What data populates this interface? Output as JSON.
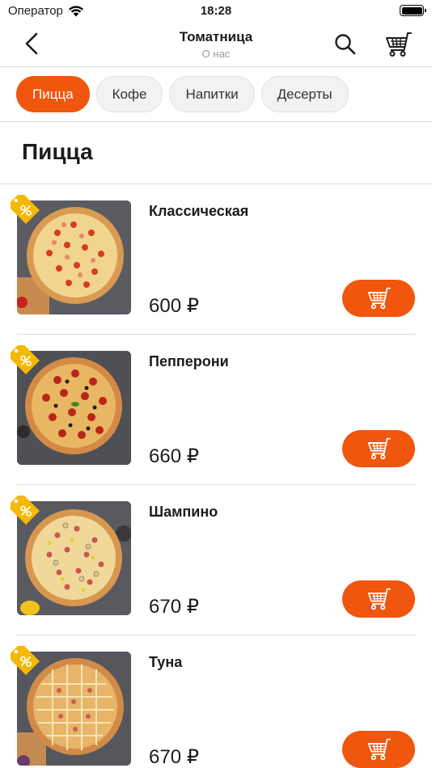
{
  "status_bar": {
    "carrier": "Оператор",
    "time": "18:28"
  },
  "nav": {
    "title": "Томатница",
    "subtitle": "О нас"
  },
  "categories": [
    {
      "label": "Пицца",
      "active": true
    },
    {
      "label": "Кофе",
      "active": false
    },
    {
      "label": "Напитки",
      "active": false
    },
    {
      "label": "Десерты",
      "active": false
    }
  ],
  "section": {
    "title": "Пицца"
  },
  "products": [
    {
      "name": "Классическая",
      "price": "600 ₽",
      "discount_badge": "%"
    },
    {
      "name": "Пепперони",
      "price": "660 ₽",
      "discount_badge": "%"
    },
    {
      "name": "Шампино",
      "price": "670 ₽",
      "discount_badge": "%"
    },
    {
      "name": "Туна",
      "price": "670 ₽",
      "discount_badge": "%"
    }
  ],
  "icons": {
    "back": "chevron-left-icon",
    "search": "search-icon",
    "cart": "cart-icon",
    "wifi": "wifi-icon",
    "battery": "battery-icon",
    "discount": "discount-tag-icon"
  },
  "colors": {
    "accent": "#f0560e",
    "badge": "#f5b800",
    "chip_bg": "#f2f2f2",
    "divider": "#dcdcdc"
  }
}
